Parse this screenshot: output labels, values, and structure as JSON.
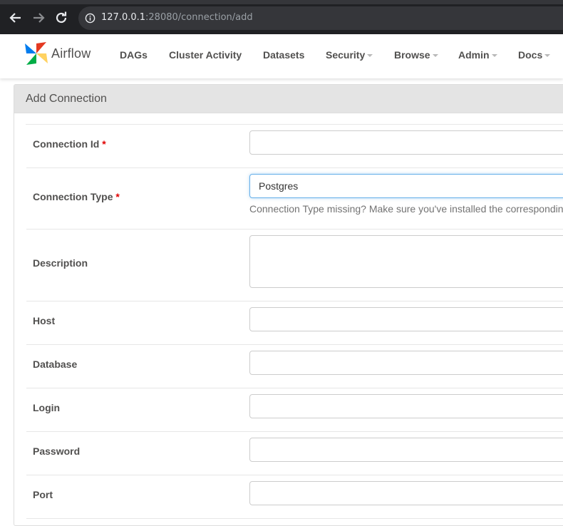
{
  "browser": {
    "url_host": "127.0.0.1",
    "url_rest": ":28080/connection/add"
  },
  "navbar": {
    "brand": "Airflow",
    "items": [
      {
        "label": "DAGs",
        "dropdown": false
      },
      {
        "label": "Cluster Activity",
        "dropdown": false
      },
      {
        "label": "Datasets",
        "dropdown": false
      },
      {
        "label": "Security",
        "dropdown": true
      },
      {
        "label": "Browse",
        "dropdown": true
      },
      {
        "label": "Admin",
        "dropdown": true
      },
      {
        "label": "Docs",
        "dropdown": true
      }
    ]
  },
  "page": {
    "title": "Add Connection"
  },
  "form": {
    "required_mark": "*",
    "connection_id": {
      "label": "Connection Id",
      "value": ""
    },
    "connection_type": {
      "label": "Connection Type",
      "value": "Postgres",
      "help": "Connection Type missing? Make sure you've installed the correspondin"
    },
    "description": {
      "label": "Description",
      "value": ""
    },
    "host": {
      "label": "Host",
      "value": ""
    },
    "database": {
      "label": "Database",
      "value": ""
    },
    "login": {
      "label": "Login",
      "value": ""
    },
    "password": {
      "label": "Password",
      "value": ""
    },
    "port": {
      "label": "Port",
      "value": ""
    }
  },
  "colors": {
    "required": "#e00000",
    "focus_border": "#66afe9",
    "text": "#51504f"
  }
}
